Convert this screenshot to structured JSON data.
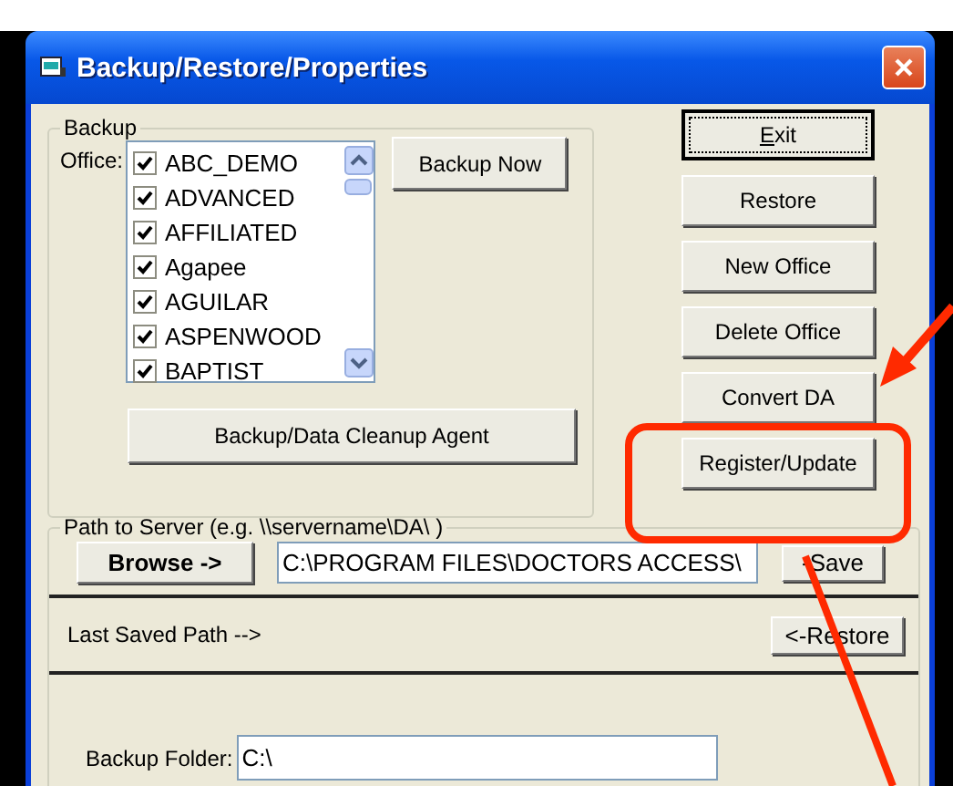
{
  "window": {
    "title": "Backup/Restore/Properties"
  },
  "backup_group": {
    "label": "Backup",
    "office_label": "Office:",
    "offices": [
      {
        "name": "ABC_DEMO",
        "checked": true
      },
      {
        "name": "ADVANCED",
        "checked": true
      },
      {
        "name": "AFFILIATED",
        "checked": true
      },
      {
        "name": "Agapee",
        "checked": true
      },
      {
        "name": "AGUILAR",
        "checked": true
      },
      {
        "name": "ASPENWOOD",
        "checked": true
      },
      {
        "name": "BAPTIST",
        "checked": true
      }
    ],
    "backup_now_button": "Backup Now",
    "cleanup_button": "Backup/Data Cleanup Agent"
  },
  "side_buttons": [
    {
      "label": "Exit",
      "default": true,
      "access_key_underlined": true
    },
    {
      "label": "Restore",
      "default": false,
      "access_key_underlined": false
    },
    {
      "label": "New Office",
      "default": false,
      "access_key_underlined": false
    },
    {
      "label": "Delete Office",
      "default": false,
      "access_key_underlined": false
    },
    {
      "label": "Convert DA",
      "default": false,
      "access_key_underlined": false
    },
    {
      "label": "Register/Update",
      "default": false,
      "access_key_underlined": false
    }
  ],
  "path_group": {
    "label": "Path to Server (e.g. \\\\servername\\DA\\ )",
    "browse_button": "Browse ->",
    "path_value": "C:\\PROGRAM FILES\\DOCTORS ACCESS\\",
    "save_button": "-Save",
    "last_saved_label": "Last Saved Path -->",
    "restore_button": "<-Restore",
    "backup_folder_label": "Backup Folder:",
    "backup_folder_value": "C:\\"
  },
  "annotations": [
    {
      "kind": "arrow"
    },
    {
      "kind": "frame"
    },
    {
      "kind": "line"
    }
  ]
}
